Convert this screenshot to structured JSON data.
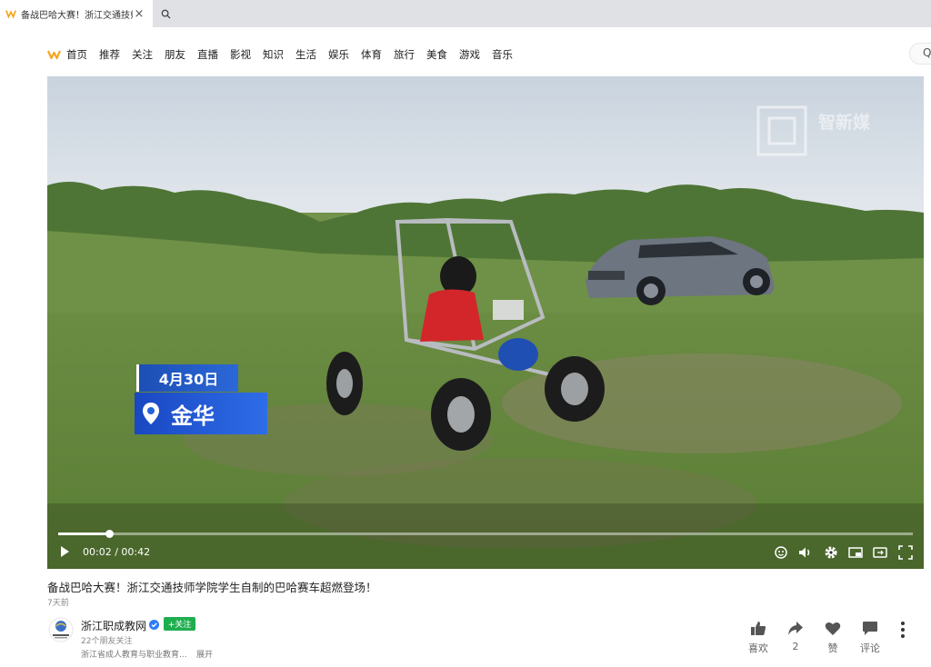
{
  "browser": {
    "tab_title": "备战巴哈大赛！浙江交通技师",
    "tab_close": "×"
  },
  "nav": {
    "items": [
      "首页",
      "推荐",
      "关注",
      "朋友",
      "直播",
      "影视",
      "知识",
      "生活",
      "娱乐",
      "体育",
      "旅行",
      "美食",
      "游戏",
      "音乐"
    ],
    "search_icon": "Q"
  },
  "video": {
    "watermark_text": "智新媒",
    "date_badge": "4月30日",
    "place_badge": "金华",
    "current_time": "00:02",
    "duration": "00:42",
    "time_display": "00:02 / 00:42",
    "progress_fraction": 0.06
  },
  "info": {
    "title": "备战巴哈大赛！浙江交通技师学院学生自制的巴哈赛车超燃登场！",
    "posted": "7天前",
    "channel_name": "浙江职成教网",
    "follow_label": "+关注",
    "friends_follow": "22个朋友关注",
    "description": "浙江省成人教育与职业教育...",
    "expand_label": "展开"
  },
  "actions": {
    "like_label": "喜欢",
    "share_count": "2",
    "upvote_label": "赞",
    "comment_label": "评论"
  },
  "colors": {
    "brand": "#f5a623",
    "follow_green": "#1fae4f",
    "badge_blue": "#2563d8"
  }
}
